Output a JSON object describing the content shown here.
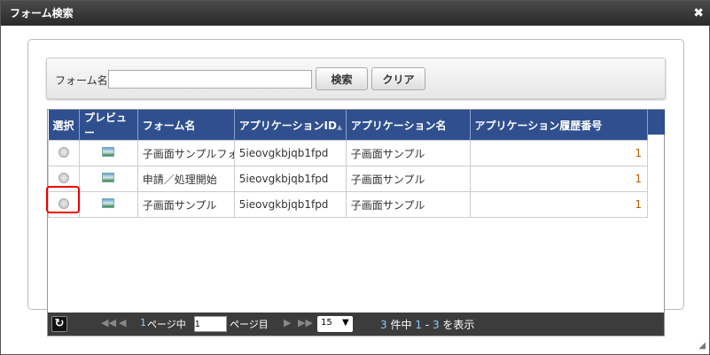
{
  "window": {
    "title": "フォーム検索",
    "close_icon": "close-icon"
  },
  "search": {
    "label": "フォーム名",
    "value": "",
    "search_button": "検索",
    "clear_button": "クリア"
  },
  "grid": {
    "columns": [
      "選択",
      "プレビュー",
      "フォーム名",
      "アプリケーションID",
      "アプリケーション名",
      "アプリケーション履歴番号"
    ],
    "sort_icon": "▲▼",
    "rows": [
      {
        "form_name": "子画面サンプルフォーム",
        "app_id": "5ieovgkbjqb1fpd",
        "app_name": "子画面サンプル",
        "history": "1"
      },
      {
        "form_name": "申請／処理開始",
        "app_id": "5ieovgkbjqb1fpd",
        "app_name": "子画面サンプル",
        "history": "1"
      },
      {
        "form_name": "子画面サンプル",
        "app_id": "5ieovgkbjqb1fpd",
        "app_name": "子画面サンプル",
        "history": "1"
      }
    ]
  },
  "pager": {
    "total_pages": "1",
    "page_of": "ページ中",
    "current_page": "1",
    "page_suffix": "ページ目",
    "page_size": "15",
    "total": "3",
    "total_suffix": "件中",
    "range_start": "1",
    "range_sep": "-",
    "range_end": "3",
    "range_suffix": "を表示"
  },
  "colors": {
    "header": "#2f4f8f",
    "highlight": "#e00000",
    "pager": "#3c3c3c"
  }
}
